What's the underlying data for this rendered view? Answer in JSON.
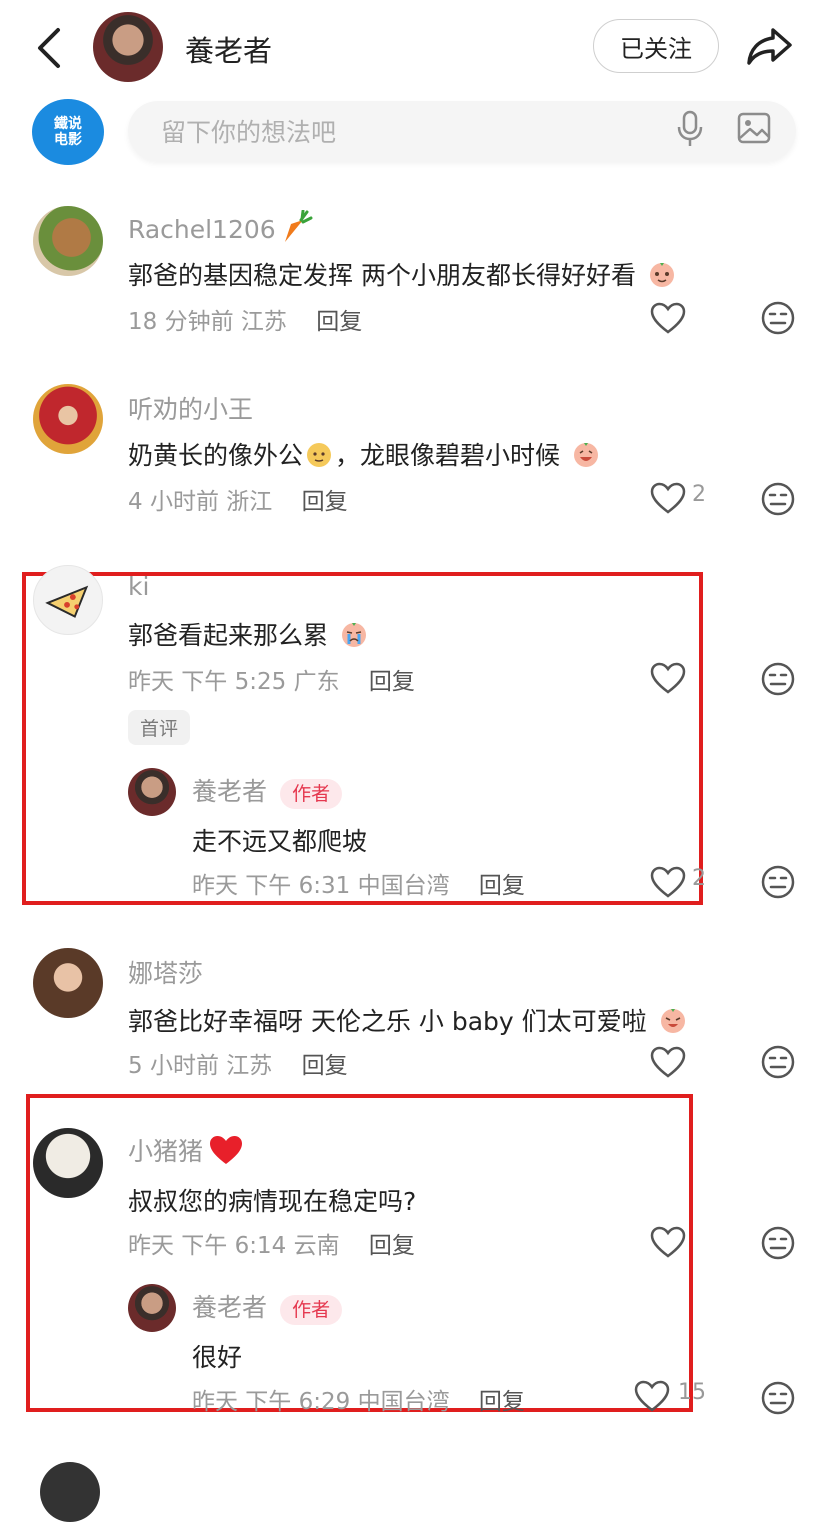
{
  "header": {
    "title": "養老者",
    "follow_label": "已关注"
  },
  "input": {
    "brand_line1": "鐵说",
    "brand_line2": "电影",
    "placeholder": "留下你的想法吧"
  },
  "comments": [
    {
      "username": "Rachel1206",
      "text": "郭爸的基因稳定发挥 两个小朋友都长得好好看",
      "time": "18 分钟前 江苏",
      "reply_label": "回复",
      "likes": ""
    },
    {
      "username": "听劝的小王",
      "text": "奶黄长的像外公",
      "text_after": "，龙眼像碧碧小时候",
      "time": "4 小时前 浙江",
      "reply_label": "回复",
      "likes": "2"
    },
    {
      "username": "ki",
      "text": "郭爸看起来那么累",
      "time": "昨天 下午 5:25 广东",
      "reply_label": "回复",
      "likes": "",
      "badge": "首评",
      "reply": {
        "username": "養老者",
        "badge": "作者",
        "text": "走不远又都爬坡",
        "time": "昨天 下午 6:31 中国台湾",
        "reply_label": "回复",
        "likes": "2"
      }
    },
    {
      "username": "娜塔莎",
      "text": "郭爸比好幸福呀 天伦之乐 小 baby 们太可爱啦",
      "time": "5 小时前 江苏",
      "reply_label": "回复",
      "likes": ""
    },
    {
      "username": "小猪猪",
      "text": "叔叔您的病情现在稳定吗?",
      "time": "昨天 下午 6:14 云南",
      "reply_label": "回复",
      "likes": "",
      "reply": {
        "username": "養老者",
        "badge": "作者",
        "text": "很好",
        "time": "昨天 下午 6:29 中国台湾",
        "reply_label": "回复",
        "likes": "15"
      }
    }
  ],
  "colors": {
    "highlight": "#e01e1e",
    "brand_blue": "#1b8be0",
    "author_badge": "#e5384f"
  }
}
